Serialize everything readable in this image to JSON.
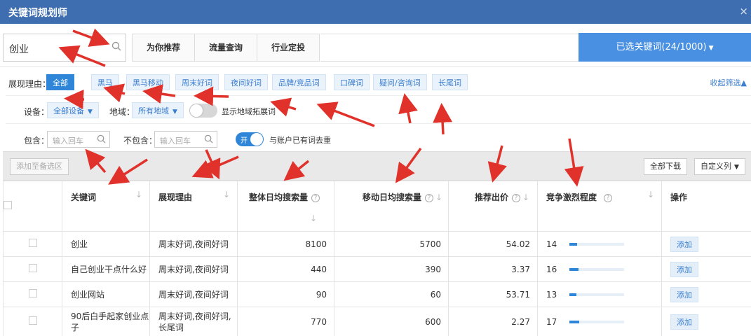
{
  "window": {
    "title": "关键词规划师",
    "close": "×"
  },
  "search": {
    "value": "创业"
  },
  "tabs": [
    {
      "label": "为你推荐"
    },
    {
      "label": "流量查询"
    },
    {
      "label": "行业定投"
    }
  ],
  "selected_keywords": {
    "label": "已选关键词(24/1000)"
  },
  "filters": {
    "reason_label": "展现理由：",
    "reasons": [
      "全部",
      "黑马",
      "黑马移动",
      "周末好词",
      "夜间好词",
      "品牌/竞品词",
      "口碑词",
      "疑问/咨询词",
      "长尾词"
    ],
    "collapse": "收起筛选▲",
    "device_label": "设备：",
    "device_value": "全部设备",
    "region_label": "地域：",
    "region_value": "所有地域",
    "show_region_label": "显示地域拓展词",
    "include_label": "包含：",
    "include_placeholder": "输入回车",
    "exclude_label": "不包含：",
    "exclude_placeholder": "输入回车",
    "dedupe_toggle": "开",
    "dedupe_label": "与账户已有词去重"
  },
  "toolbar": {
    "add_to_pool": "添加至备选区",
    "download_all": "全部下载",
    "custom_columns": "自定义列"
  },
  "table": {
    "headers": {
      "keyword": "关键词",
      "reason": "展现理由",
      "overall": "整体日均搜索量",
      "mobile": "移动日均搜索量",
      "bid": "推荐出价",
      "competition": "竞争激烈程度",
      "action": "操作"
    },
    "sort_arrow": "↓",
    "help": "?",
    "rows": [
      {
        "keyword": "创业",
        "reason": "周末好词,夜间好词",
        "overall": "8100",
        "mobile": "5700",
        "bid": "54.02",
        "competition": "14",
        "competition_level": 0.14,
        "action": "添加"
      },
      {
        "keyword": "自己创业干点什么好",
        "reason": "周末好词,夜间好词",
        "overall": "440",
        "mobile": "390",
        "bid": "3.37",
        "competition": "16",
        "competition_level": 0.16,
        "action": "添加"
      },
      {
        "keyword": "创业网站",
        "reason": "周末好词,夜间好词",
        "overall": "90",
        "mobile": "60",
        "bid": "53.71",
        "competition": "13",
        "competition_level": 0.13,
        "action": "添加"
      },
      {
        "keyword": "90后白手起家创业点子",
        "reason": "周末好词,夜间好词,长尾词",
        "overall": "770",
        "mobile": "600",
        "bid": "2.27",
        "competition": "17",
        "competition_level": 0.17,
        "action": "添加"
      }
    ]
  },
  "colors": {
    "titlebar": "#3e6db0",
    "accent": "#2f86d9",
    "annotation_arrow": "#e0322b"
  }
}
